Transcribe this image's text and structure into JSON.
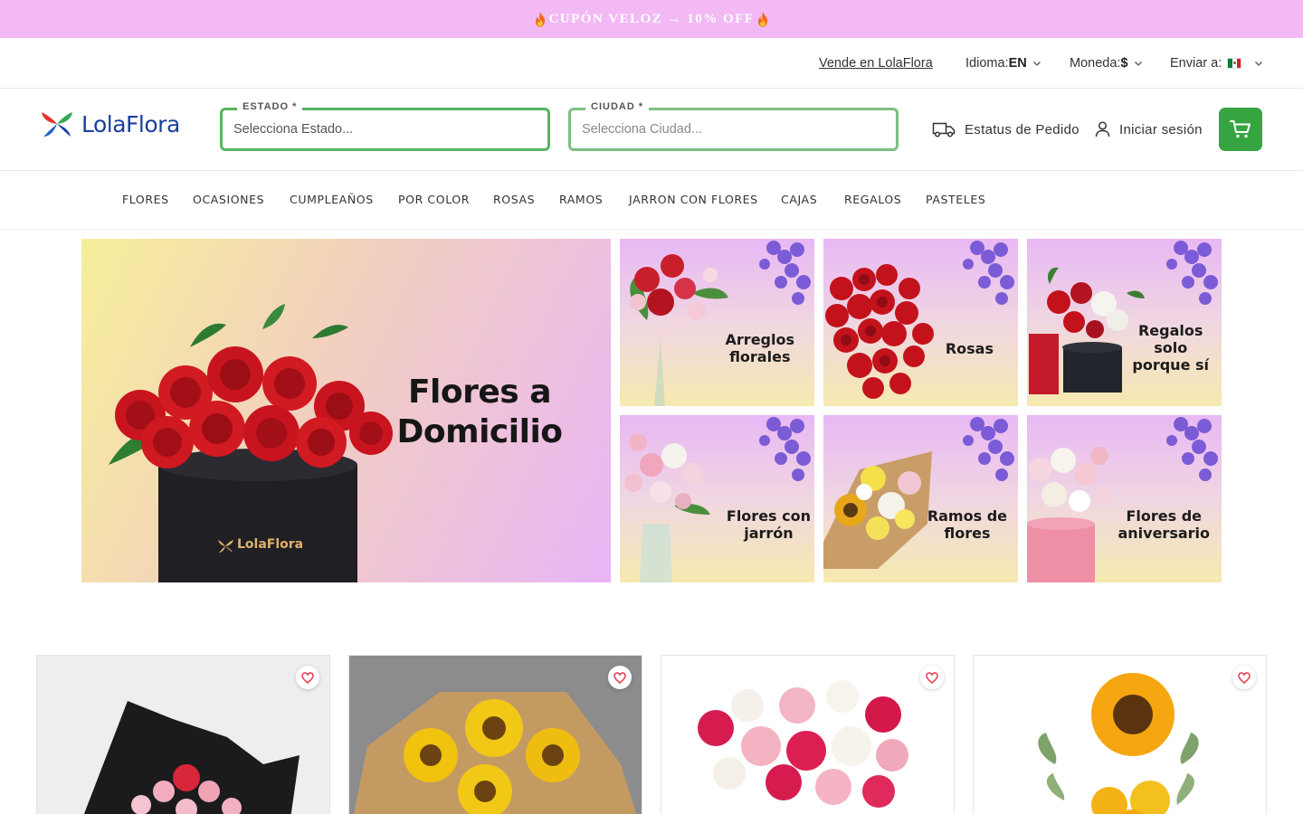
{
  "promo": {
    "text": "CUPÓN VELOZ → 10% OFF"
  },
  "utility": {
    "sell_label": "Vende en LolaFlora",
    "language_label": "Idioma:",
    "language_value": "EN",
    "currency_label": "Moneda:",
    "currency_value": "$",
    "ship_label": "Enviar a:",
    "ship_country_flag": "mexico-flag-icon"
  },
  "header": {
    "brand": "LolaFlora",
    "estado": {
      "label": "ESTADO *",
      "placeholder": "Selecciona Estado..."
    },
    "ciudad": {
      "label": "CIUDAD *",
      "placeholder": "Selecciona Ciudad..."
    },
    "order_status_label": "Estatus de Pedido",
    "login_label": "Iniciar sesión"
  },
  "nav": {
    "items": [
      "FLORES",
      "OCASIONES",
      "CUMPLEAÑOS",
      "POR COLOR",
      "ROSAS",
      "RAMOS",
      "JARRON CON FLORES",
      "CAJAS",
      "REGALOS",
      "PASTELES"
    ]
  },
  "hero": {
    "main": {
      "line1": "Flores a",
      "line2": "Domicilio",
      "box_brand": "LolaFlora"
    },
    "tiles": [
      {
        "line1": "Arreglos",
        "line2": "florales",
        "line3": ""
      },
      {
        "line1": "Rosas",
        "line2": "",
        "line3": ""
      },
      {
        "line1": "Regalos",
        "line2": "solo",
        "line3": "porque sí"
      },
      {
        "line1": "Flores con",
        "line2": "jarrón",
        "line3": ""
      },
      {
        "line1": "Ramos de",
        "line2": "flores",
        "line3": ""
      },
      {
        "line1": "Flores de",
        "line2": "aniversario",
        "line3": ""
      }
    ]
  },
  "products": [
    {
      "image": "black-wrapped-bouquet"
    },
    {
      "image": "sunflower-bouquet"
    },
    {
      "image": "pink-white-roses-gerberas"
    },
    {
      "image": "single-sunflower-arrangement"
    }
  ],
  "colors": {
    "promo_bg": "#f2b9f5",
    "accent_green": "#37a442",
    "brand_blue": "#1b3f9c"
  }
}
